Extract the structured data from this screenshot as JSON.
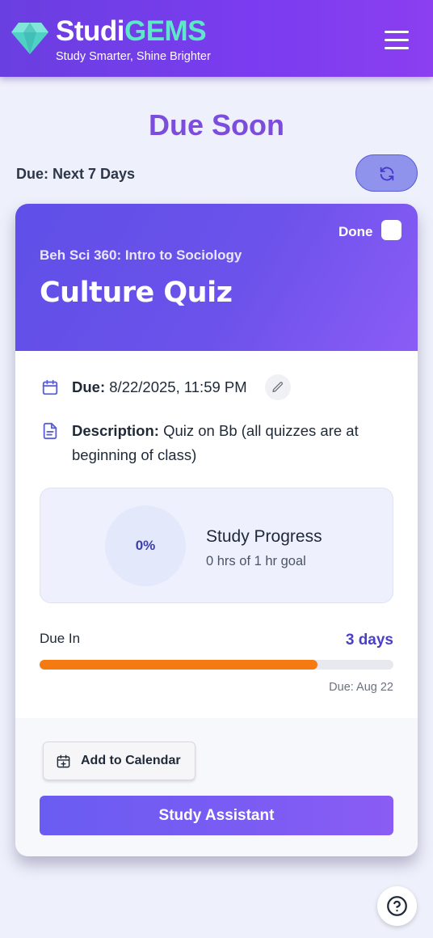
{
  "header": {
    "brand_part1": "Studi",
    "brand_part2": "GEMS",
    "tagline": "Study Smarter, Shine Brighter",
    "logo_icon": "gem-icon",
    "menu_icon": "hamburger-menu-icon"
  },
  "page": {
    "title": "Due Soon",
    "range_label": "Due: Next 7 Days",
    "refresh_icon": "refresh-icon"
  },
  "assignment": {
    "done_label": "Done",
    "done_checked": false,
    "course": "Beh Sci 360: Intro to Sociology",
    "title": "Culture Quiz",
    "due_label": "Due:",
    "due_value": "8/22/2025, 11:59 PM",
    "description_label": "Description:",
    "description_value": "Quiz on Bb (all quizzes are at beginning of class)",
    "progress": {
      "percent_text": "0%",
      "title": "Study Progress",
      "subtitle": "0 hrs of 1 hr goal"
    },
    "due_in": {
      "label": "Due In",
      "value": "3 days",
      "bar_fraction": 0.786,
      "due_short": "Due: Aug 22"
    },
    "actions": {
      "calendar_label": "Add to Calendar",
      "assistant_label": "Study Assistant"
    }
  },
  "help_icon": "help-question-icon",
  "colors": {
    "header_gradient_start": "#6a3fe0",
    "header_gradient_end": "#8b3ff0",
    "brand_accent": "#5ee7c9",
    "title_purple": "#7c4ddc",
    "progress_bar": "#f57a12",
    "due_in_value": "#4a3fc9"
  }
}
